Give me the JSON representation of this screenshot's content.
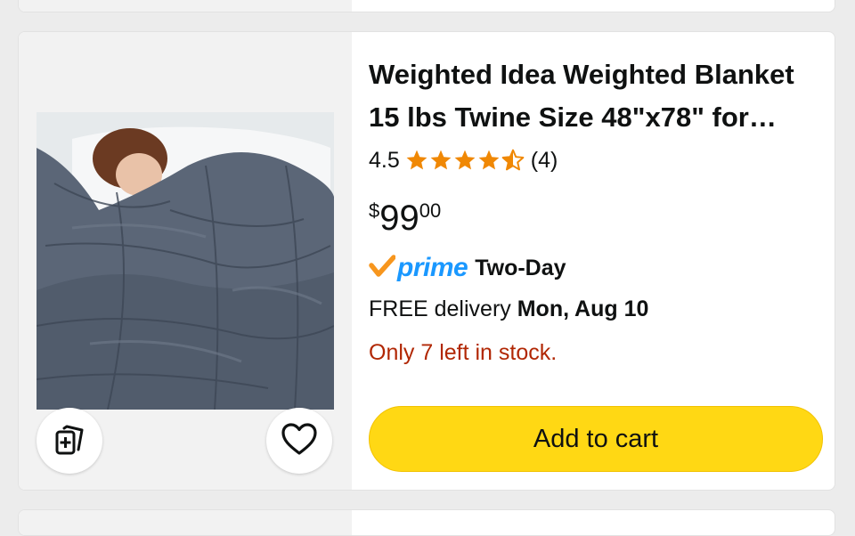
{
  "product": {
    "title_line1": "Weighted Idea Weighted Blanket",
    "title_line2": "15 lbs Twine Size 48\"x78\" for…",
    "rating": "4.5",
    "stars": 4.5,
    "review_count": "(4)",
    "price_symbol": "$",
    "price_whole": "99",
    "price_fraction": "00",
    "prime_label": "prime",
    "prime_speed": "Two-Day",
    "delivery_prefix": "FREE delivery",
    "delivery_date": "Mon, Aug 10",
    "stock_text": "Only 7 left in stock.",
    "add_to_cart_label": "Add to cart"
  },
  "colors": {
    "star": "#f08804",
    "prime_blue": "#1a98ff",
    "prime_check": "#f7961e",
    "stock_red": "#b12704",
    "cart_button": "#ffd814"
  },
  "icons": {
    "compare": "compare-icon",
    "wishlist": "heart-icon"
  }
}
